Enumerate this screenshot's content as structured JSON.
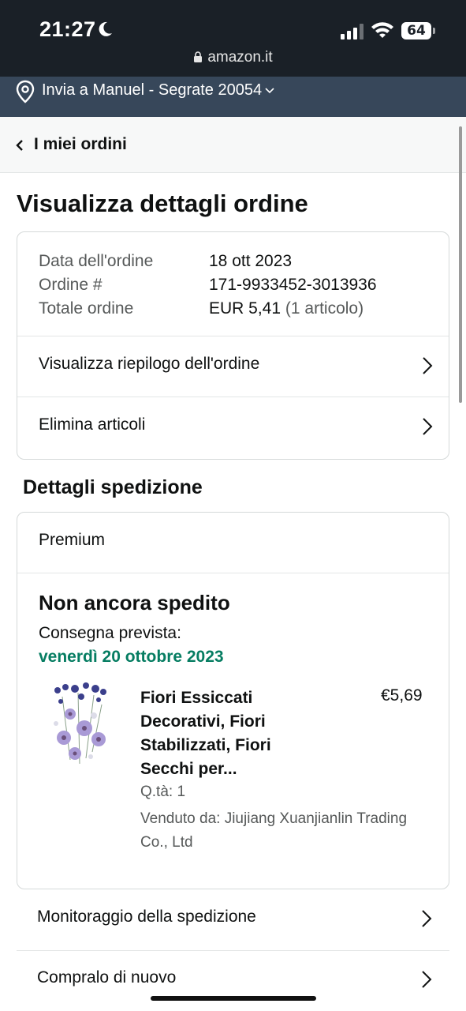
{
  "status_bar": {
    "time": "21:27",
    "battery": "64",
    "url": "amazon.it"
  },
  "delivery": {
    "label": "Invia a Manuel - Segrate 20054"
  },
  "breadcrumb": {
    "label": "I miei ordini"
  },
  "page_title": "Visualizza dettagli ordine",
  "order": {
    "date_label": "Data dell'ordine",
    "date_value": "18 ott 2023",
    "number_label": "Ordine #",
    "number_value": "171-9933452-3013936",
    "total_label": "Totale ordine",
    "total_value": "EUR 5,41",
    "total_items": "(1 articolo)",
    "summary_link": "Visualizza riepilogo dell'ordine",
    "delete_link": "Elimina articoli"
  },
  "shipping": {
    "section_title": "Dettagli spedizione",
    "type": "Premium",
    "status": "Non ancora spedito",
    "expected_label": "Consegna prevista:",
    "expected_date": "venerdì 20 ottobre 2023",
    "product": {
      "title": "Fiori Essiccati Decorativi, Fiori Stabilizzati, Fiori Secchi per...",
      "price": "€5,69",
      "qty": "Q.tà: 1",
      "seller": "Venduto da: Jiujiang Xuanjianlin Trading Co., Ltd"
    }
  },
  "actions": {
    "track": "Monitoraggio della spedizione",
    "buy_again": "Compralo di nuovo"
  },
  "colors": {
    "status_bar_bg": "#1a2027",
    "delivery_bar_bg": "#37475a",
    "delivery_date_green": "#067d62"
  }
}
